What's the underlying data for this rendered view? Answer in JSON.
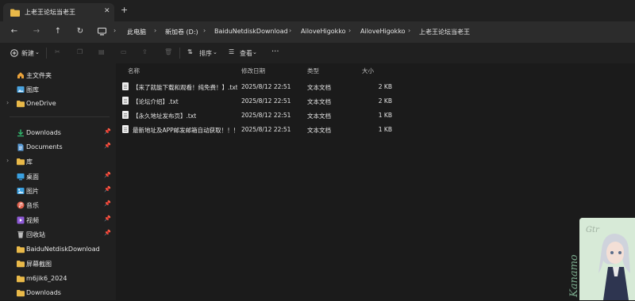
{
  "tab": {
    "title": "上老王论坛当老王",
    "close": "✕",
    "new_tab": "+"
  },
  "nav": {
    "back": "←",
    "forward": "→",
    "up": "↑",
    "refresh": "↻"
  },
  "address": {
    "crumbs": [
      "此电脑",
      "新加卷 (D:)",
      "BaiduNetdiskDownload",
      "AiloveHigokko",
      "AiloveHigokko",
      "上老王论坛当老王"
    ],
    "separator": "›"
  },
  "toolbar": {
    "new_label": "新建",
    "sort_label": "排序",
    "view_label": "查看",
    "more_label": "···"
  },
  "sidebar": {
    "items": [
      {
        "label": "主文件夹",
        "icon": "home-icon",
        "color": "#e9a23b"
      },
      {
        "label": "图库",
        "icon": "gallery-icon",
        "color": "#4aa3df"
      },
      {
        "label": "OneDrive",
        "icon": "folder-icon",
        "color": "#e9b949"
      },
      {
        "label": "Downloads",
        "icon": "download-icon",
        "color": "#31b06a"
      },
      {
        "label": "Documents",
        "icon": "documents-icon",
        "color": "#5b9bd5"
      },
      {
        "label": "库",
        "icon": "folder-icon",
        "color": "#e9b949"
      },
      {
        "label": "桌面",
        "icon": "desktop-icon",
        "color": "#3aa0e0"
      },
      {
        "label": "图片",
        "icon": "pictures-icon",
        "color": "#3aa0e0"
      },
      {
        "label": "音乐",
        "icon": "music-icon",
        "color": "#e2624e"
      },
      {
        "label": "视频",
        "icon": "video-icon",
        "color": "#8e5ad6"
      },
      {
        "label": "回收站",
        "icon": "recycle-bin-icon",
        "color": "#bdbdbd"
      },
      {
        "label": "BaiduNetdiskDownload",
        "icon": "folder-icon",
        "color": "#e9b949"
      },
      {
        "label": "屏幕截图",
        "icon": "folder-icon",
        "color": "#e9b949"
      },
      {
        "label": "m6jik6_2024",
        "icon": "folder-icon",
        "color": "#e9b949"
      },
      {
        "label": "Downloads",
        "icon": "folder-icon",
        "color": "#e9b949"
      }
    ]
  },
  "columns": {
    "name": "名称",
    "modified": "修改日期",
    "type": "类型",
    "size": "大小"
  },
  "files": [
    {
      "name": "【来了就能下载和观看！纯免费！】.txt",
      "modified": "2025/8/12 22:51",
      "type": "文本文档",
      "size": "2 KB"
    },
    {
      "name": "【论坛介绍】.txt",
      "modified": "2025/8/12 22:51",
      "type": "文本文档",
      "size": "2 KB"
    },
    {
      "name": "【永久地址发布页】.txt",
      "modified": "2025/8/12 22:51",
      "type": "文本文档",
      "size": "1 KB"
    },
    {
      "name": "最新地址及APP邮发邮箱自动获取！！！...",
      "modified": "2025/8/12 22:51",
      "type": "文本文档",
      "size": "1 KB"
    }
  ],
  "art": {
    "signature": "Kanamo",
    "initials": "Gtr"
  }
}
